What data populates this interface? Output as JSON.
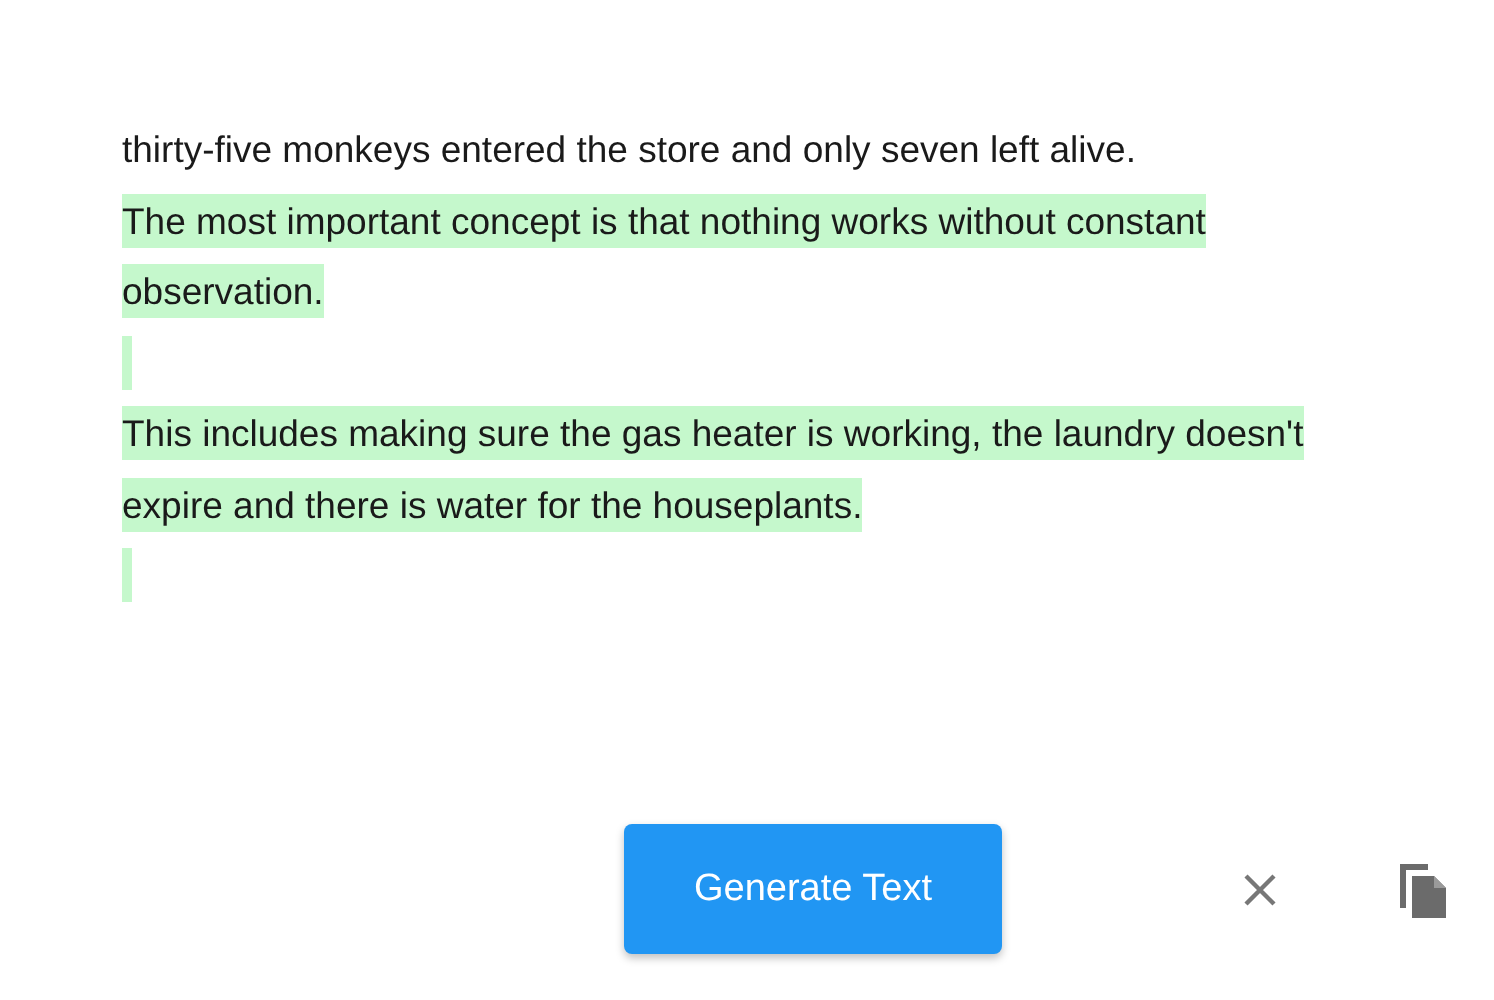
{
  "paragraphs": [
    {
      "kind": "text",
      "highlighted": false,
      "lines": [
        "thirty-five monkeys entered the store and only seven left alive."
      ]
    },
    {
      "kind": "text",
      "highlighted": true,
      "lines": [
        "The most important concept is that nothing works without constant",
        "observation."
      ]
    },
    {
      "kind": "blank",
      "highlighted": true
    },
    {
      "kind": "text",
      "highlighted": true,
      "lines": [
        "This includes making sure the gas heater is working, the laundry doesn't",
        "expire and there is water for the houseplants."
      ]
    },
    {
      "kind": "blank",
      "highlighted": true
    }
  ],
  "generate_button": {
    "label": "Generate Text"
  }
}
